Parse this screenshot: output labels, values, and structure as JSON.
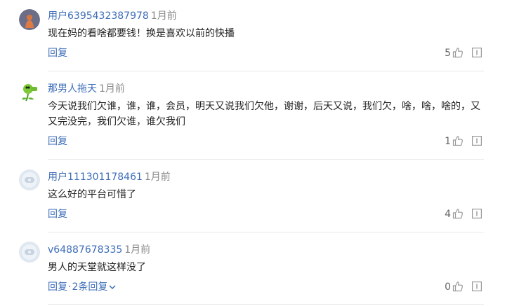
{
  "comments": [
    {
      "user": "用户6395432387978",
      "time": "1月前",
      "text": "现在妈的看啥都要钱！换是喜欢以前的快播",
      "reply_label": "回复",
      "replies_label": "",
      "likes": "5",
      "avatar": "orange-figure-avatar"
    },
    {
      "user": "那男人拖天",
      "time": "1月前",
      "text": "今天说我们欠谁，谁，谁，会员，明天又说我们欠他，谢谢，后天又说，我们欠，啥，啥，啥的，又又完没完，我们欠谁，谁欠我们",
      "reply_label": "回复",
      "replies_label": "",
      "likes": "1",
      "avatar": "peashooter-avatar"
    },
    {
      "user": "用户111301178461",
      "time": "1月前",
      "text": "这么好的平台可惜了",
      "reply_label": "回复",
      "replies_label": "",
      "likes": "4",
      "avatar": "default-user-avatar"
    },
    {
      "user": "v64887678335",
      "time": "1月前",
      "text": "男人的天堂就这样没了",
      "reply_label": "回复",
      "replies_label": "2条回复",
      "likes": "0",
      "avatar": "default-user-avatar"
    }
  ],
  "colors": {
    "username": "#3d6db8",
    "action": "#3d6db8",
    "divider": "#e8e8e8"
  }
}
